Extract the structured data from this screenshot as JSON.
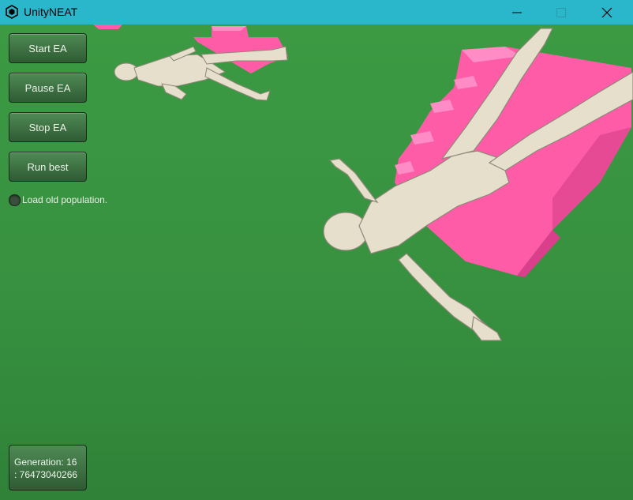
{
  "window": {
    "title": "UnityNEAT",
    "colors": {
      "titlebar": "#2ab7cc",
      "ground": "#3a8f40",
      "stairs": "#ff5ca8",
      "figure": "#e6dfcc"
    }
  },
  "controls": {
    "start_label": "Start EA",
    "pause_label": "Pause EA",
    "stop_label": "Stop EA",
    "run_best_label": "Run best",
    "load_population_label": "Load old population.",
    "load_population_checked": false
  },
  "status": {
    "generation_line": "Generation: 16",
    "fitness_line": ": 76473040266"
  },
  "icons": {
    "app": "unity-logo-icon",
    "minimize": "minimize-icon",
    "maximize": "maximize-icon",
    "close": "close-icon"
  }
}
